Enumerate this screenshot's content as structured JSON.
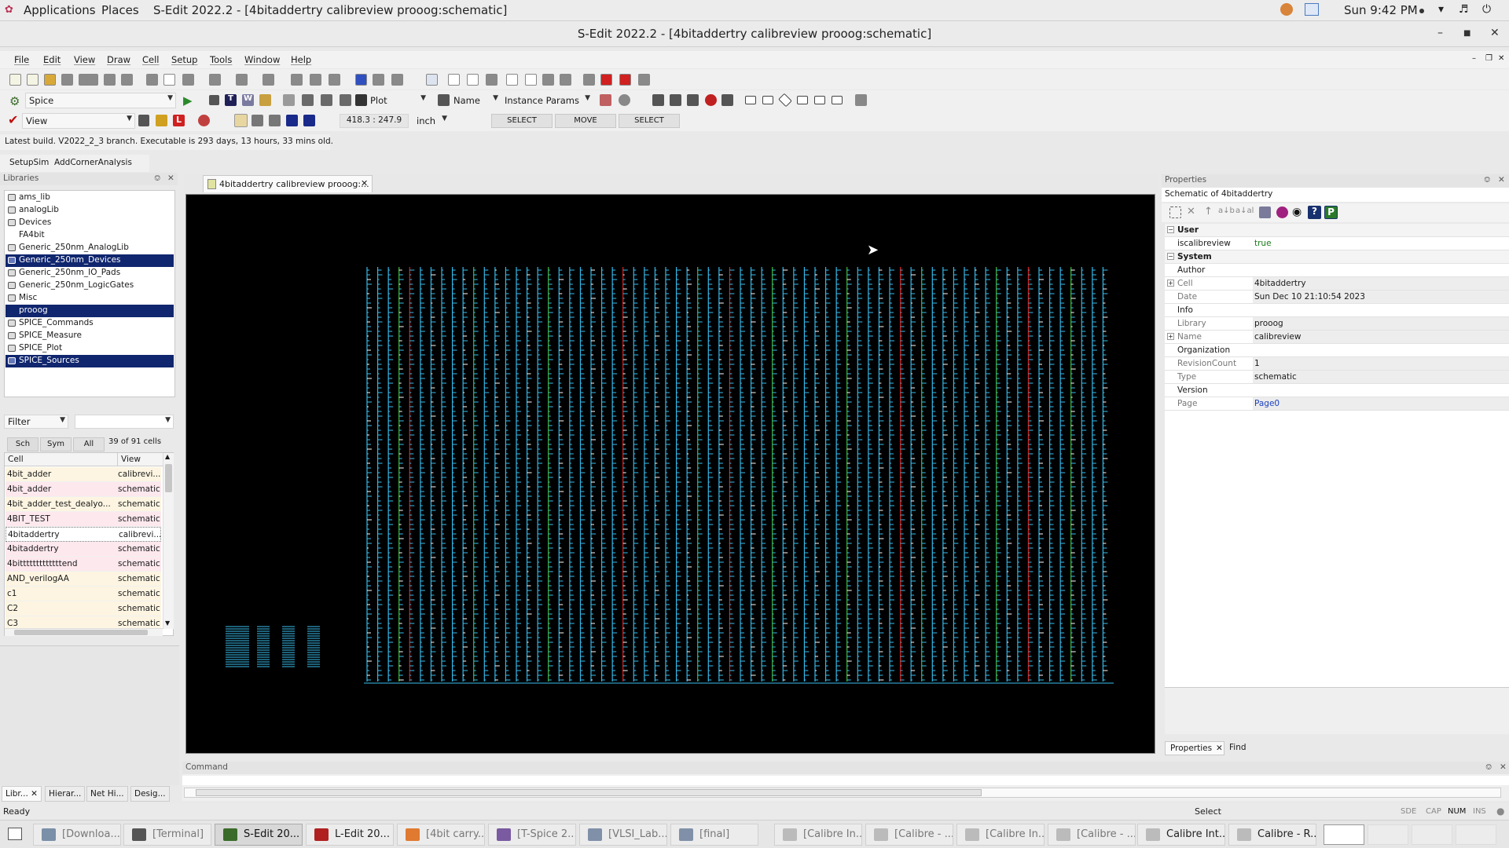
{
  "topbar": {
    "applications": "Applications",
    "places": "Places",
    "window_title": "S-Edit 2022.2 - [4bitaddertry calibreview prooog:schematic]",
    "clock": "Sun  9:42 PM"
  },
  "window": {
    "title": "S-Edit 2022.2 - [4bitaddertry calibreview prooog:schematic]"
  },
  "menu": [
    "File",
    "Edit",
    "View",
    "Draw",
    "Cell",
    "Setup",
    "Tools",
    "Window",
    "Help"
  ],
  "toolbar": {
    "sim_engine": "Spice",
    "plot": "Plot",
    "name": "Name",
    "instance_params": "Instance Params",
    "mode": "View",
    "coords": "418.3 : 247.9",
    "units": "inch",
    "btn_select1": "SELECT",
    "btn_move": "MOVE",
    "btn_select2": "SELECT"
  },
  "build_status": "Latest build. V2022_2_3 branch. Executable is 293 days, 13 hours, 33 mins old.",
  "sim_buttons": {
    "setup": "SetupSim",
    "corner": "AddCornerAnalysis"
  },
  "libraries": {
    "header": "Libraries",
    "items": [
      {
        "label": "ams_lib",
        "selected": false
      },
      {
        "label": "analogLib",
        "selected": false
      },
      {
        "label": "Devices",
        "selected": false
      },
      {
        "label": "FA4bit",
        "selected": false
      },
      {
        "label": "Generic_250nm_AnalogLib",
        "selected": false
      },
      {
        "label": "Generic_250nm_Devices",
        "selected": true
      },
      {
        "label": "Generic_250nm_IO_Pads",
        "selected": false
      },
      {
        "label": "Generic_250nm_LogicGates",
        "selected": false
      },
      {
        "label": "Misc",
        "selected": false
      },
      {
        "label": "prooog",
        "selected": true
      },
      {
        "label": "SPICE_Commands",
        "selected": false
      },
      {
        "label": "SPICE_Measure",
        "selected": false
      },
      {
        "label": "SPICE_Plot",
        "selected": false
      },
      {
        "label": "SPICE_Sources",
        "selected": true
      }
    ],
    "filter_label": "Filter",
    "tabs": [
      "Sch",
      "Sym",
      "All"
    ],
    "cell_count": "39 of 91 cells",
    "col_cell": "Cell",
    "col_view": "View",
    "cells": [
      {
        "cell": "4bit_adder",
        "view": "calibrevi..."
      },
      {
        "cell": "4bit_adder",
        "view": "schematic"
      },
      {
        "cell": "4bit_adder_test_dealyo...",
        "view": "schematic"
      },
      {
        "cell": "4BIT_TEST",
        "view": "schematic"
      },
      {
        "cell": "4bitaddertry",
        "view": "calibrevi..."
      },
      {
        "cell": "4bitaddertry",
        "view": "schematic"
      },
      {
        "cell": "4bitttttttttttttend",
        "view": "schematic"
      },
      {
        "cell": "AND_verilogAA",
        "view": "schematic"
      },
      {
        "cell": "c1",
        "view": "schematic"
      },
      {
        "cell": "C2",
        "view": "schematic"
      },
      {
        "cell": "C3",
        "view": "schematic"
      }
    ],
    "bottom_tabs": [
      "Libr...",
      "Hierar...",
      "Net Hi...",
      "Desig..."
    ]
  },
  "document_tab": "4bitaddertry calibreview prooog:...",
  "properties": {
    "header": "Properties",
    "subtitle": "Schematic of 4bitaddertry",
    "rows": [
      {
        "key": "User",
        "section": true
      },
      {
        "key": "iscalibreview",
        "value": "true",
        "color": "#1a7a1a"
      },
      {
        "key": "System",
        "section": true
      },
      {
        "key": "Author",
        "value": ""
      },
      {
        "key": "Cell",
        "value": "4bitaddertry",
        "expand": true
      },
      {
        "key": "Date",
        "value": "Sun Dec 10 21:10:54 2023"
      },
      {
        "key": "Info",
        "value": ""
      },
      {
        "key": "Library",
        "value": "prooog"
      },
      {
        "key": "Name",
        "value": "calibreview",
        "expand": true
      },
      {
        "key": "Organization",
        "value": ""
      },
      {
        "key": "RevisionCount",
        "value": "1"
      },
      {
        "key": "Type",
        "value": "schematic"
      },
      {
        "key": "Version",
        "value": ""
      },
      {
        "key": "Page",
        "value": "Page0",
        "color": "#1a3fbf"
      }
    ],
    "tabs": [
      "Properties",
      "Find"
    ]
  },
  "command": {
    "header": "Command"
  },
  "status": {
    "ready": "Ready",
    "select": "Select",
    "indicators": [
      "SDE",
      "CAP",
      "NUM",
      "INS"
    ]
  },
  "taskbar": [
    {
      "label": "[Downloa...",
      "icon": "#7a8fa8"
    },
    {
      "label": "[Terminal]",
      "icon": "#555555"
    },
    {
      "label": "S-Edit 20...",
      "icon": "#3a6b2a",
      "focus": true
    },
    {
      "label": "L-Edit 20...",
      "icon": "#b02020",
      "active": true
    },
    {
      "label": "[4bit carry...",
      "icon": "#e07a30"
    },
    {
      "label": "[T-Spice 2...",
      "icon": "#7a5aa0"
    },
    {
      "label": "[VLSI_Lab...",
      "icon": "#8090a8"
    },
    {
      "label": "[final]",
      "icon": "#8090a8"
    },
    {
      "label": "[Calibre In...",
      "icon": "#bbbbbb"
    },
    {
      "label": "[Calibre - ...",
      "icon": "#bbbbbb"
    },
    {
      "label": "[Calibre In...",
      "icon": "#bbbbbb"
    },
    {
      "label": "[Calibre - ...",
      "icon": "#bbbbbb"
    },
    {
      "label": "Calibre Int...",
      "icon": "#bbbbbb",
      "active": true
    },
    {
      "label": "Calibre - R...",
      "icon": "#bbbbbb",
      "active": true
    }
  ]
}
